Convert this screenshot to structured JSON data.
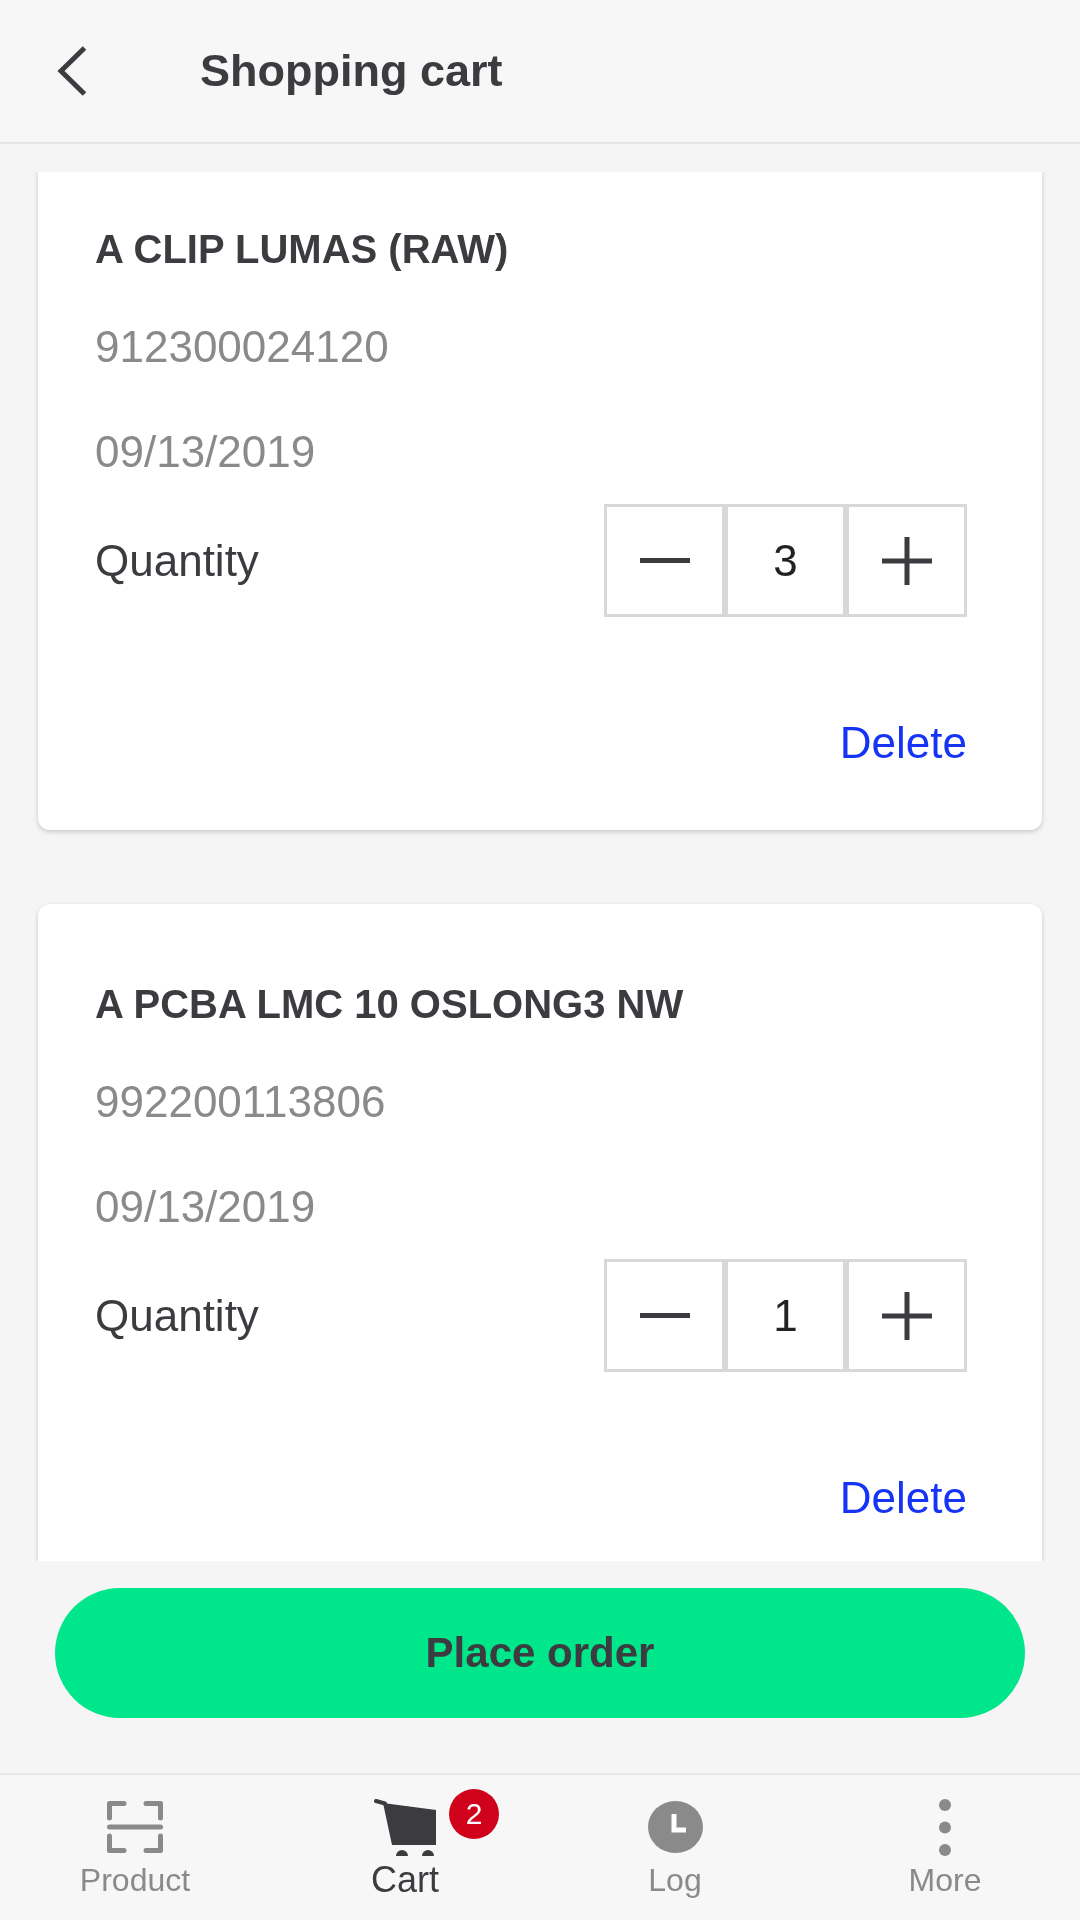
{
  "header": {
    "title": "Shopping cart"
  },
  "cart_items": [
    {
      "name": "A CLIP LUMAS (RAW)",
      "code": "912300024120",
      "date": "09/13/2019",
      "quantity_label": "Quantity",
      "quantity": "3",
      "delete_label": "Delete"
    },
    {
      "name": "A PCBA LMC 10 OSLONG3 NW",
      "code": "992200113806",
      "date": "09/13/2019",
      "quantity_label": "Quantity",
      "quantity": "1",
      "delete_label": "Delete"
    }
  ],
  "place_order": {
    "label": "Place order"
  },
  "bottom_nav": [
    {
      "label": "Product",
      "kind": "scan",
      "selected": false
    },
    {
      "label": "Cart",
      "kind": "cart",
      "selected": true,
      "badge": "2"
    },
    {
      "label": "Log",
      "kind": "clock",
      "selected": false
    },
    {
      "label": "More",
      "kind": "more",
      "selected": false
    }
  ]
}
